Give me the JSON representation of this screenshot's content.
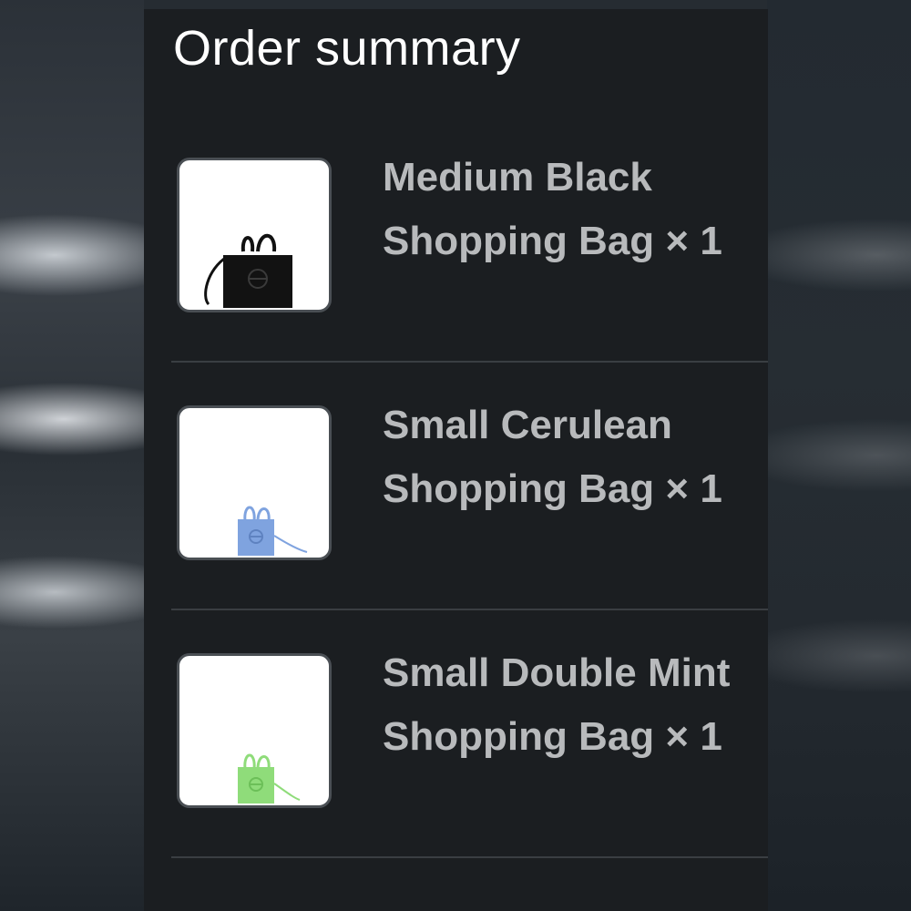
{
  "header": {
    "title": "Order summary"
  },
  "items": [
    {
      "line1": "Medium Black",
      "line2": "Shopping Bag × 1",
      "image_icon": "black-tote-bag-icon",
      "color": "#111111"
    },
    {
      "line1": "Small Cerulean",
      "line2": "Shopping Bag × 1",
      "image_icon": "cerulean-tote-bag-icon",
      "color": "#7fa3df"
    },
    {
      "line1": "Small Double Mint",
      "line2": "Shopping Bag × 1",
      "image_icon": "mint-tote-bag-icon",
      "color": "#8fdc7a"
    }
  ]
}
